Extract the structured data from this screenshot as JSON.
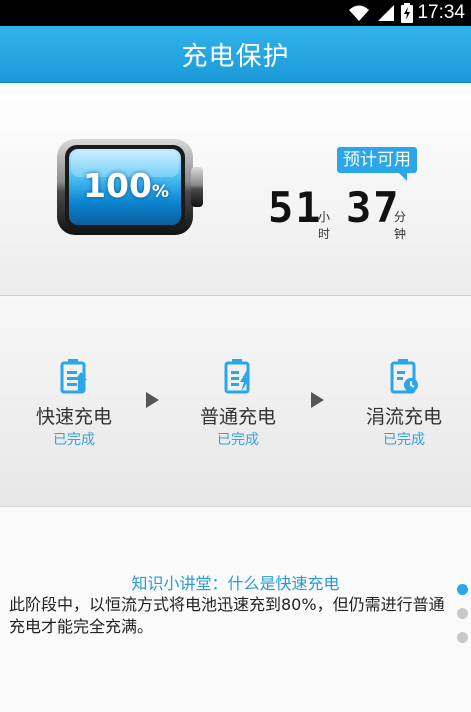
{
  "status_bar": {
    "time": "17:34",
    "icons": [
      "wifi-icon",
      "signal-icon",
      "battery-charging-icon"
    ]
  },
  "app": {
    "title": "充电保护"
  },
  "battery": {
    "percent": "100",
    "percent_sign": "%",
    "level": 1.0
  },
  "estimate": {
    "label": "预计可用",
    "hours": "51",
    "hours_unit": "小时",
    "minutes": "37",
    "minutes_unit": "分钟"
  },
  "stages": [
    {
      "label": "快速充电",
      "status": "已完成",
      "icon": "fast-charge-icon"
    },
    {
      "label": "普通充电",
      "status": "已完成",
      "icon": "normal-charge-icon"
    },
    {
      "label": "涓流充电",
      "status": "已完成",
      "icon": "trickle-charge-icon"
    }
  ],
  "knowledge": {
    "title": "知识小讲堂：什么是快速充电",
    "text": "此阶段中，以恒流方式将电池迅速充到80%，但仍需进行普通充电才能完全充满。"
  },
  "pager": {
    "count": 3,
    "active_index": 0
  },
  "colors": {
    "accent": "#2ba6e8",
    "appbar": "#1b9ad8"
  }
}
